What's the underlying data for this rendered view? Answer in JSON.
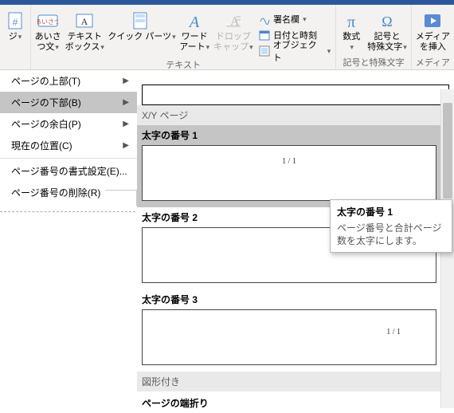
{
  "ribbon": {
    "page_btn": "ジ",
    "greeting_btn": "あいさ\nつ文",
    "textbox_btn": "テキスト\nボックス",
    "quickparts_btn": "クイック パーツ",
    "wordart_btn": "ワード\nアート",
    "dropcap_btn": "ドロップ\nキャップ",
    "signature": "署名欄",
    "datetime": "日付と時刻",
    "object": "オブジェクト",
    "equation": "数式",
    "symbol": "記号と\n特殊文字",
    "media": "メディア\nを挿入",
    "group_text": "テキスト",
    "group_symbols": "記号と特殊文字",
    "group_media": "メディア"
  },
  "menu": {
    "top": "ページの上部(T)",
    "bottom": "ページの下部(B)",
    "margin": "ページの余白(P)",
    "current": "現在の位置(C)",
    "format": "ページ番号の書式設定(E)...",
    "remove": "ページ番号の削除(R)"
  },
  "submenu": {
    "xy_label": "X/Y ページ",
    "item1_title": "太字の番号 1",
    "item2_title": "太字の番号 2",
    "item3_title": "太字の番号 3",
    "page_display": "1 / 1",
    "shape_section": "図形付き",
    "edge_title": "ページの端折り"
  },
  "tooltip": {
    "title": "太字の番号 1",
    "body": "ページ番号と合計ページ数を太字にします。"
  }
}
